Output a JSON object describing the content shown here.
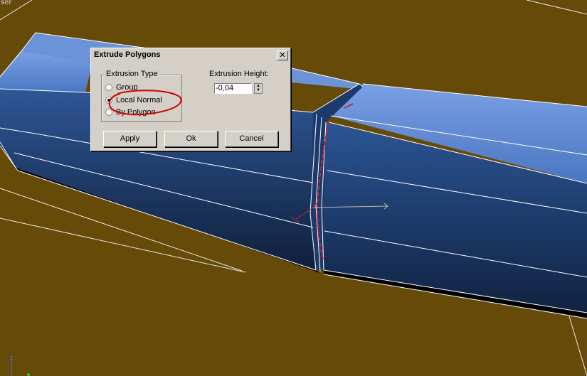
{
  "viewport": {
    "label": "ser",
    "axis_label": "z"
  },
  "dialog": {
    "title": "Extrude Polygons",
    "close_label": "✕",
    "extrusion_type": {
      "label": "Extrusion Type",
      "options": [
        "Group",
        "Local Normal",
        "By Polygon"
      ],
      "selected": "Local Normal"
    },
    "extrusion_height": {
      "label": "Extrusion Height:",
      "value": "-0,04"
    },
    "buttons": {
      "apply": "Apply",
      "ok": "Ok",
      "cancel": "Cancel"
    }
  },
  "colors": {
    "viewport_bg": "#664a08",
    "mesh_top": "#5d86cf",
    "mesh_dark": "#13284a",
    "selection": "#d0202c",
    "annotation": "#d00000"
  }
}
